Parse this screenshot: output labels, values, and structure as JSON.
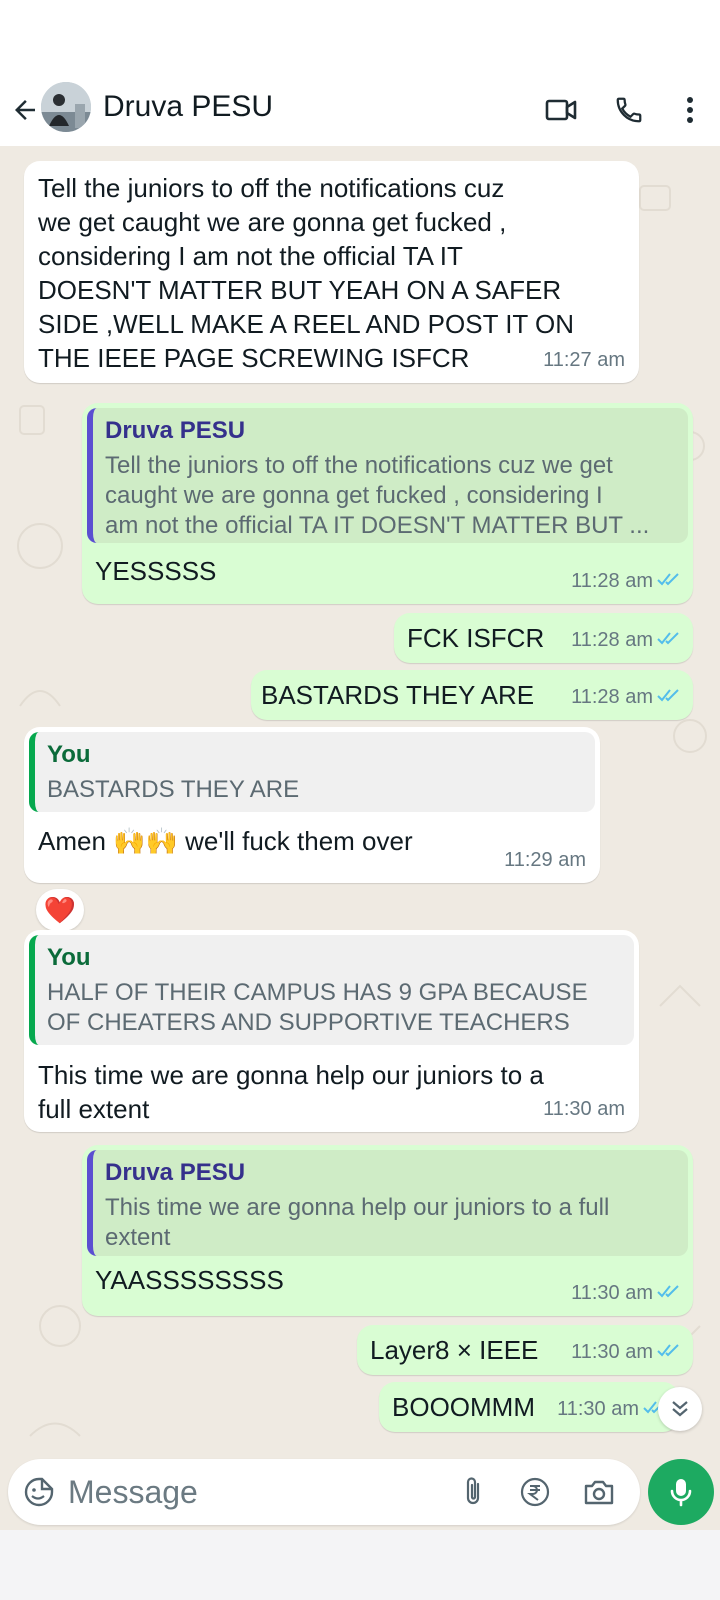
{
  "header": {
    "contact_name": "Druva PESU"
  },
  "icons": {
    "back": "arrow-left-icon",
    "video": "video-call-icon",
    "call": "phone-icon",
    "menu": "more-vert-icon",
    "emoji": "emoji-sticker-icon",
    "attach": "paperclip-icon",
    "payment": "rupee-icon",
    "camera": "camera-icon",
    "mic": "microphone-icon",
    "scroll": "double-chevron-down-icon"
  },
  "colors": {
    "incoming_bubble": "#ffffff",
    "outgoing_bubble": "#d9fdd3",
    "chat_background": "#efeae2",
    "read_ticks": "#53bdeb",
    "mic_button": "#1daa61"
  },
  "messages": [
    {
      "direction": "in",
      "text": "Tell the juniors to off the notifications cuz\nwe get caught we are gonna get fucked ,\nconsidering I am not the official TA IT\nDOESN'T MATTER BUT YEAH ON A SAFER\nSIDE ,WELL MAKE A REEL AND POST IT ON\nTHE IEEE PAGE SCREWING ISFCR",
      "time": "11:27 am"
    },
    {
      "direction": "out",
      "quote": {
        "name": "Druva PESU",
        "text": "Tell the juniors to off the notifications cuz we get\ncaught we are gonna get fucked , considering I\nam not the official TA IT DOESN'T MATTER BUT ..."
      },
      "text": "YESSSSS",
      "time": "11:28 am"
    },
    {
      "direction": "out",
      "text": "FCK ISFCR",
      "time": "11:28 am"
    },
    {
      "direction": "out",
      "text": "BASTARDS THEY ARE",
      "time": "11:28 am"
    },
    {
      "direction": "in",
      "quote": {
        "name": "You",
        "text": "BASTARDS THEY ARE"
      },
      "text_before": "Amen ",
      "emoji": "🙌🙌",
      "text_after": " we'll fuck them over",
      "time": "11:29 am",
      "reaction": "❤️"
    },
    {
      "direction": "in",
      "quote": {
        "name": "You",
        "text": "HALF OF THEIR CAMPUS HAS 9 GPA BECAUSE\nOF CHEATERS AND SUPPORTIVE TEACHERS"
      },
      "text": "This time we are gonna help our juniors to a\nfull extent",
      "time": "11:30 am"
    },
    {
      "direction": "out",
      "quote": {
        "name": "Druva PESU",
        "text": "This time we are gonna help our juniors to a full\nextent"
      },
      "text": "YAASSSSSSSS",
      "time": "11:30 am"
    },
    {
      "direction": "out",
      "text": "Layer8 × IEEE",
      "time": "11:30 am"
    },
    {
      "direction": "out",
      "text": "BOOOMMM",
      "time": "11:30 am"
    }
  ],
  "composer": {
    "placeholder": "Message"
  }
}
